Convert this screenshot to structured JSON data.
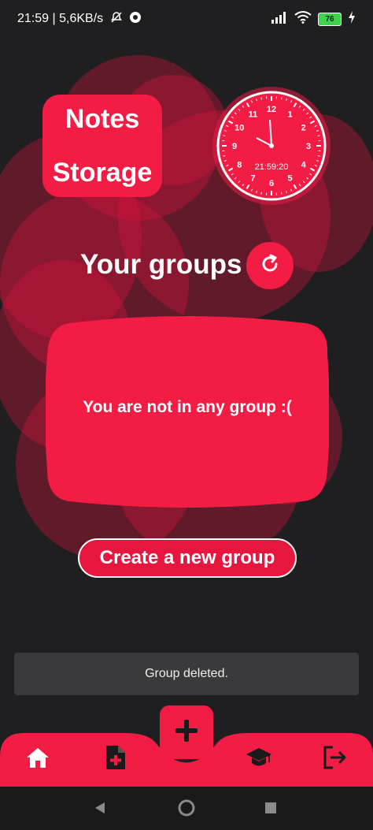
{
  "status_bar": {
    "time": "21:59",
    "speed": "5,6KB/s",
    "battery": "76"
  },
  "app": {
    "logo_line1": "Notes",
    "logo_line2": "Storage"
  },
  "clock": {
    "digital_time": "21:59:20",
    "numbers": [
      "12",
      "1",
      "2",
      "3",
      "4",
      "5",
      "6",
      "7",
      "8",
      "9",
      "10",
      "11"
    ]
  },
  "groups": {
    "title": "Your groups",
    "empty_message": "You are not in any group :(",
    "create_label": "Create a new group"
  },
  "toast": {
    "message": "Group deleted."
  },
  "icons": {
    "refresh": "refresh-icon",
    "home": "home-icon",
    "add_note": "add-file-icon",
    "add": "plus-icon",
    "education": "graduation-cap-icon",
    "logout": "logout-icon",
    "wifi": "wifi-icon",
    "signal": "signal-icon"
  },
  "colors": {
    "accent": "#f21c45",
    "background": "#1f1e20"
  }
}
